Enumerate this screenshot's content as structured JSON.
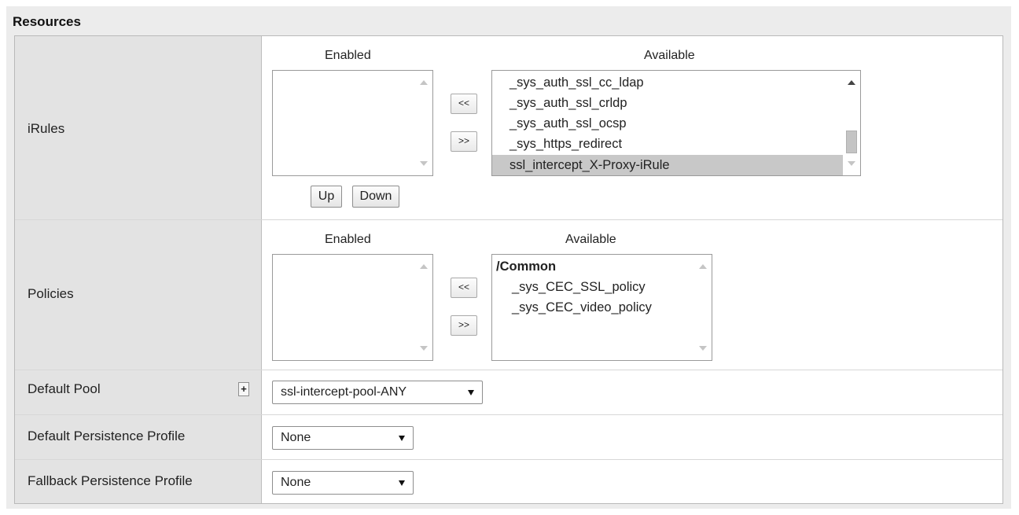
{
  "section_title": "Resources",
  "irules": {
    "label": "iRules",
    "enabled_header": "Enabled",
    "available_header": "Available",
    "move_left_label": "<<",
    "move_right_label": ">>",
    "up_label": "Up",
    "down_label": "Down",
    "enabled_items": [],
    "available_items": [
      "_sys_auth_ssl_cc_ldap",
      "_sys_auth_ssl_crldp",
      "_sys_auth_ssl_ocsp",
      "_sys_https_redirect",
      "ssl_intercept_X-Proxy-iRule"
    ],
    "selected_available": "ssl_intercept_X-Proxy-iRule"
  },
  "policies": {
    "label": "Policies",
    "enabled_header": "Enabled",
    "available_header": "Available",
    "move_left_label": "<<",
    "move_right_label": ">>",
    "enabled_items": [],
    "available_group": "/Common",
    "available_items": [
      "_sys_CEC_SSL_policy",
      "_sys_CEC_video_policy"
    ]
  },
  "default_pool": {
    "label": "Default Pool",
    "add_label": "+",
    "value": "ssl-intercept-pool-ANY"
  },
  "default_persistence": {
    "label": "Default Persistence Profile",
    "value": "None"
  },
  "fallback_persistence": {
    "label": "Fallback Persistence Profile",
    "value": "None"
  },
  "icons": {
    "scroll_up": "scroll-up-arrow-icon",
    "scroll_down": "scroll-down-arrow-icon",
    "dropdown": "dropdown-arrow-icon",
    "add": "plus-icon"
  }
}
